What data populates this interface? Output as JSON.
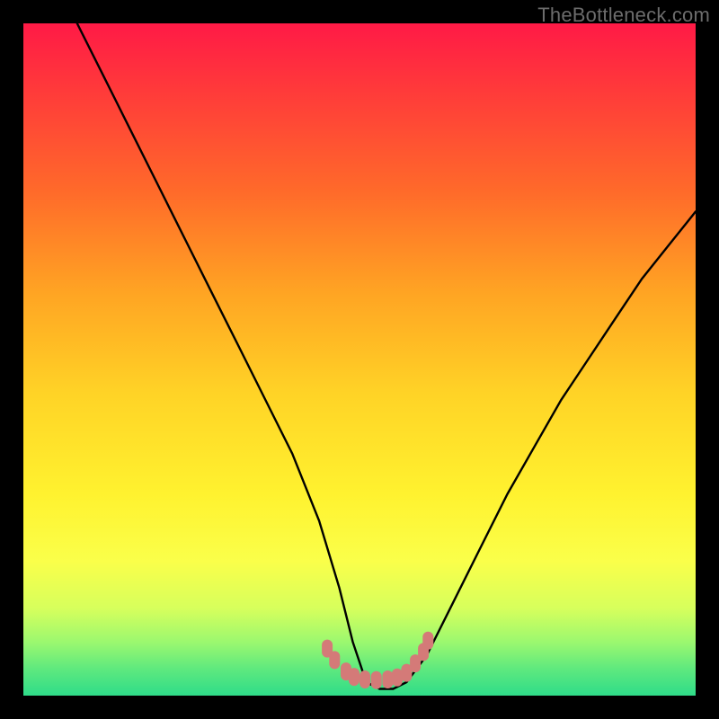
{
  "watermark": "TheBottleneck.com",
  "chart_data": {
    "type": "line",
    "title": "",
    "xlabel": "",
    "ylabel": "",
    "xlim": [
      0,
      100
    ],
    "ylim": [
      0,
      100
    ],
    "series": [
      {
        "name": "curve",
        "x": [
          8,
          12,
          16,
          20,
          24,
          28,
          32,
          36,
          40,
          44,
          47,
          49,
          51,
          53,
          55,
          57,
          60,
          64,
          68,
          72,
          76,
          80,
          84,
          88,
          92,
          96,
          100
        ],
        "y": [
          100,
          92,
          84,
          76,
          68,
          60,
          52,
          44,
          36,
          26,
          16,
          8,
          2,
          1,
          1,
          2,
          6,
          14,
          22,
          30,
          37,
          44,
          50,
          56,
          62,
          67,
          72
        ]
      }
    ],
    "markers": {
      "name": "bottom-markers",
      "color": "#d47a78",
      "points": [
        {
          "x": 45.2,
          "y": 7.0
        },
        {
          "x": 46.3,
          "y": 5.3
        },
        {
          "x": 48.0,
          "y": 3.6
        },
        {
          "x": 49.2,
          "y": 2.8
        },
        {
          "x": 50.8,
          "y": 2.4
        },
        {
          "x": 52.5,
          "y": 2.3
        },
        {
          "x": 54.2,
          "y": 2.4
        },
        {
          "x": 55.6,
          "y": 2.7
        },
        {
          "x": 57.0,
          "y": 3.4
        },
        {
          "x": 58.3,
          "y": 4.8
        },
        {
          "x": 59.5,
          "y": 6.5
        },
        {
          "x": 60.2,
          "y": 8.2
        }
      ]
    }
  }
}
